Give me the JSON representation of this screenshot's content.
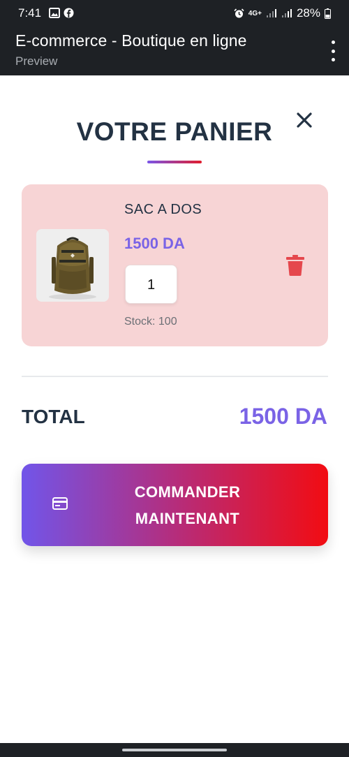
{
  "status_bar": {
    "time": "7:41",
    "left_icons": [
      "image-icon",
      "facebook-icon"
    ],
    "network": "4G+",
    "battery": "28%"
  },
  "app_bar": {
    "title": "E-commerce - Boutique en ligne",
    "subtitle": "Preview",
    "menu_icon": "more-vert-icon"
  },
  "cart": {
    "title": "VOTRE PANIER",
    "close_icon": "close-icon",
    "items": [
      {
        "name": "SAC A DOS",
        "price": "1500 DA",
        "quantity": "1",
        "stock": "Stock: 100",
        "image_icon": "backpack-image",
        "delete_icon": "trash-icon"
      }
    ],
    "total_label": "TOTAL",
    "total_value": "1500 DA",
    "checkout_icon": "credit-card-icon",
    "checkout_label": "COMMANDER MAINTENANT"
  },
  "colors": {
    "header_bg": "#1e2125",
    "title": "#233243",
    "accent": "#7a63e6",
    "card_bg": "#f7d4d5",
    "danger": "#e5474d",
    "gradient_start": "#7155e9",
    "gradient_end": "#f20c12"
  }
}
